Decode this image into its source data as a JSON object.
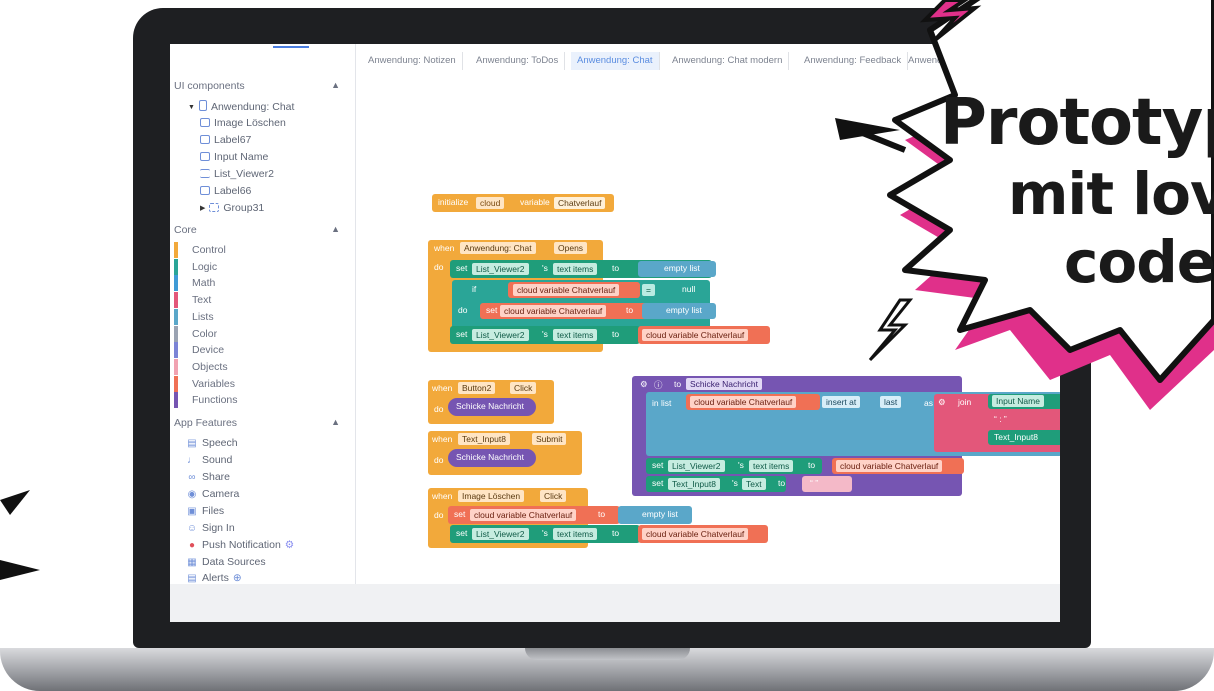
{
  "tabs": {
    "back_arrow": "‹",
    "items": [
      {
        "label": "Anwendung: Notizen"
      },
      {
        "label": "Anwendung: ToDos"
      },
      {
        "label": "Anwendung: Chat"
      },
      {
        "label": "Anwendung: Chat modern"
      },
      {
        "label": "Anwendung: Feedback"
      },
      {
        "label": "Anwendung: Feed"
      }
    ],
    "active_index": 2
  },
  "sidebar": {
    "ui_components": {
      "title": "UI components",
      "root": "Anwendung: Chat",
      "items": [
        {
          "label": "Image Löschen",
          "icon": "image-icon"
        },
        {
          "label": "Label67",
          "icon": "label-icon"
        },
        {
          "label": "Input Name",
          "icon": "input-icon"
        },
        {
          "label": "List_Viewer2",
          "icon": "list-icon"
        },
        {
          "label": "Label66",
          "icon": "label-icon"
        },
        {
          "label": "Group31",
          "icon": "group-icon"
        }
      ]
    },
    "core": {
      "title": "Core",
      "items": [
        {
          "label": "Control",
          "color": "#f2a93b"
        },
        {
          "label": "Logic",
          "color": "#2aa597"
        },
        {
          "label": "Math",
          "color": "#3f9bd6"
        },
        {
          "label": "Text",
          "color": "#e3577a"
        },
        {
          "label": "Lists",
          "color": "#5aa7c9"
        },
        {
          "label": "Color",
          "color": "#9aa3b2"
        },
        {
          "label": "Device",
          "color": "#7c84d6"
        },
        {
          "label": "Objects",
          "color": "#f1a2b1"
        },
        {
          "label": "Variables",
          "color": "#f07055"
        },
        {
          "label": "Functions",
          "color": "#7655b2"
        }
      ]
    },
    "app_features": {
      "title": "App Features",
      "items": [
        {
          "label": "Speech",
          "icon": "speech-icon"
        },
        {
          "label": "Sound",
          "icon": "sound-icon"
        },
        {
          "label": "Share",
          "icon": "share-icon"
        },
        {
          "label": "Camera",
          "icon": "camera-icon"
        },
        {
          "label": "Files",
          "icon": "files-icon"
        },
        {
          "label": "Sign In",
          "icon": "sign-in-icon"
        },
        {
          "label": "Push Notification",
          "icon": "push-icon"
        },
        {
          "label": "Data Sources",
          "icon": "data-sources-icon"
        },
        {
          "label": "Alerts",
          "icon": "alerts-icon"
        }
      ]
    }
  },
  "blocks": {
    "init": {
      "initialize": "initialize",
      "scope": "cloud",
      "variable": "variable",
      "name": "Chatverlauf"
    },
    "when_opens": {
      "when": "when",
      "component": "Anwendung: Chat",
      "event": "Opens",
      "do": "do",
      "set": "set",
      "target": "List_Viewer2",
      "possessive": "'s",
      "prop": "text items",
      "to": "to",
      "empty_list": "empty list",
      "if": "if",
      "cloud_var": "cloud variable Chatverlauf",
      "eq": "=",
      "null": "null"
    },
    "when_button": {
      "when": "when",
      "component": "Button2",
      "event": "Click",
      "do": "do",
      "call": "Schicke Nachricht"
    },
    "when_input": {
      "when": "when",
      "component": "Text_Input8",
      "event": "Submit",
      "do": "do",
      "call": "Schicke Nachricht"
    },
    "when_image": {
      "when": "when",
      "component": "Image Löschen",
      "event": "Click",
      "do": "do"
    },
    "procedure": {
      "to": "to",
      "name": "Schicke Nachricht",
      "in_list": "in list",
      "insert_at": "insert at",
      "last": "last",
      "as": "as",
      "join": "join",
      "input_name": "Input Name",
      "quote_colon": "“ : ”",
      "text_input8": "Text_Input8",
      "text": "Text",
      "quote_empty": "“ ”"
    }
  },
  "promo": {
    "line1": "Prototyp",
    "line2": "mit lov",
    "line3": "code"
  }
}
